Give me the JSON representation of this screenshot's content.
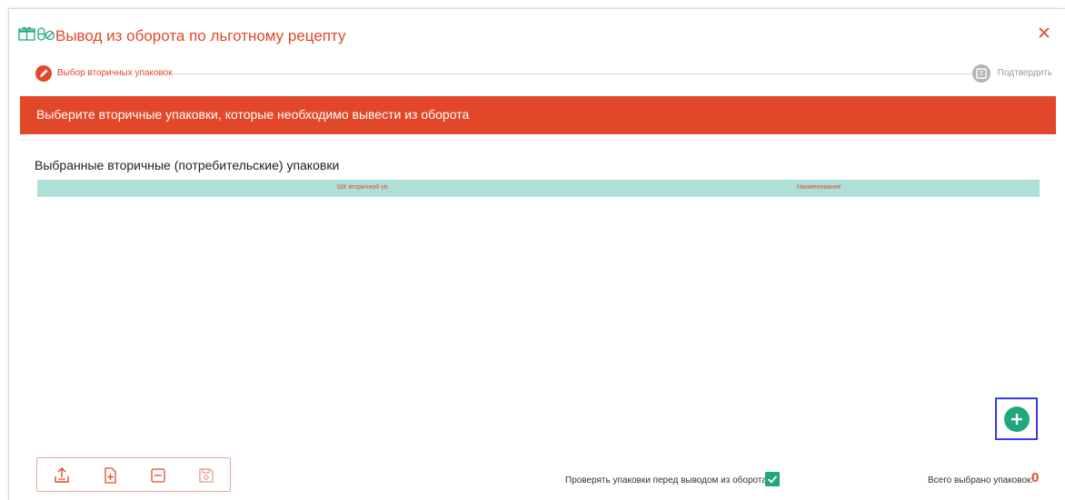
{
  "dialog": {
    "title": "Вывод из оборота по льготному рецепту",
    "header_icons": [
      "gift-box-icon",
      "pills-icon"
    ],
    "close_icon": "close-icon"
  },
  "stepper": {
    "steps": [
      {
        "label": "Выбор вторичных упаковок",
        "icon": "pencil-icon",
        "active": true
      },
      {
        "label": "Подтвердить",
        "icon": "stamp-icon",
        "active": false
      }
    ]
  },
  "banner": {
    "text": "Выберите вторичные упаковки, которые необходимо вывести из оборота"
  },
  "section": {
    "title": "Выбранные вторичные (потребительские) упаковки",
    "columns": [
      "ШК вторичной уп.",
      "Наименование"
    ],
    "rows": []
  },
  "toolbar": {
    "buttons": [
      "upload-icon",
      "add-file-icon",
      "remove-icon",
      "save-icon"
    ]
  },
  "footer": {
    "check_label": "Проверять упаковки перед выводом из оборота",
    "check_value": true,
    "total_label": "Всего выбрано упаковок:",
    "total_count": "0"
  },
  "colors": {
    "accent": "#e3472a",
    "table_header": "#aee0da",
    "success": "#21a77e"
  }
}
